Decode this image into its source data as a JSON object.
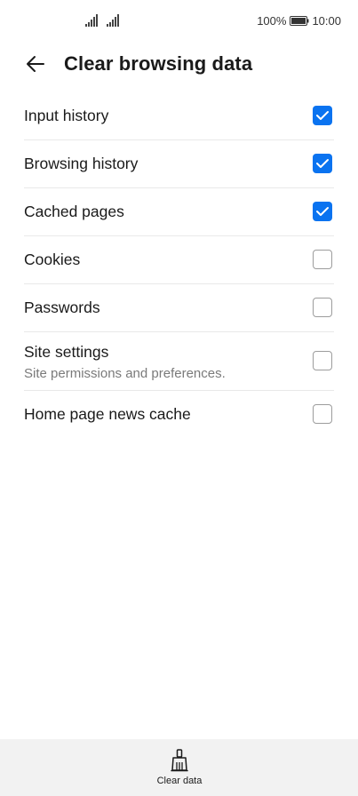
{
  "status_bar": {
    "battery": "100%",
    "time": "10:00"
  },
  "header": {
    "title": "Clear browsing data"
  },
  "options": [
    {
      "label": "Input history",
      "sublabel": "",
      "checked": true
    },
    {
      "label": "Browsing history",
      "sublabel": "",
      "checked": true
    },
    {
      "label": "Cached pages",
      "sublabel": "",
      "checked": true
    },
    {
      "label": "Cookies",
      "sublabel": "",
      "checked": false
    },
    {
      "label": "Passwords",
      "sublabel": "",
      "checked": false
    },
    {
      "label": "Site settings",
      "sublabel": "Site permissions and preferences.",
      "checked": false
    },
    {
      "label": "Home page news cache",
      "sublabel": "",
      "checked": false
    }
  ],
  "bottom_bar": {
    "clear_label": "Clear data"
  },
  "colors": {
    "accent": "#0a73f0",
    "checkbox_border": "#9c9c9c",
    "bottom_bar_bg": "#f2f2f2"
  }
}
